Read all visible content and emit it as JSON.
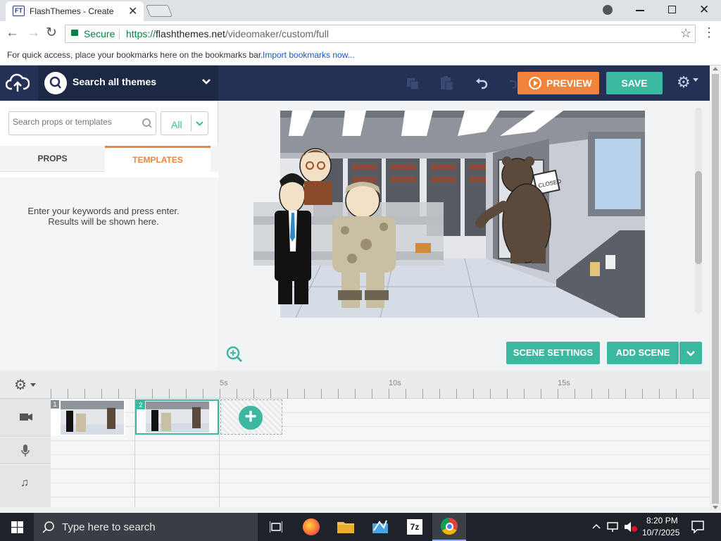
{
  "browser": {
    "tab_title": "FlashThemes - Create",
    "tab_favicon_text": "FT",
    "secure_label": "Secure",
    "url_prefix": "https://",
    "url_host": "flashthemes.net",
    "url_path": "/videomaker/custom/full",
    "bookmarks_hint": "For quick access, place your bookmarks here on the bookmarks bar.",
    "import_bookmarks": "Import bookmarks now..."
  },
  "header": {
    "search_themes_label": "Search all themes",
    "preview_label": "PREVIEW",
    "save_label": "SAVE"
  },
  "left_panel": {
    "search_placeholder": "Search props or templates",
    "filter_value": "All",
    "tabs": [
      {
        "label": "PROPS",
        "active": false
      },
      {
        "label": "TEMPLATES",
        "active": true
      }
    ],
    "results_hint_line1": "Enter your keywords and press enter.",
    "results_hint_line2": "Results will be shown here."
  },
  "stage": {
    "closed_sign": "CLOSED",
    "scene_settings_label": "SCENE SETTINGS",
    "add_scene_label": "ADD SCENE"
  },
  "timeline": {
    "ticks": [
      "5s",
      "10s",
      "15s"
    ],
    "scenes": [
      {
        "number": "1",
        "selected": false
      },
      {
        "number": "2",
        "selected": true
      }
    ]
  },
  "taskbar": {
    "search_placeholder": "Type here to search",
    "time": "8:20 PM",
    "date": "10/7/2025",
    "sevenzip_label": "7z"
  },
  "colors": {
    "header_bg": "#243156",
    "accent_teal": "#3db8a0",
    "accent_orange": "#f0843a",
    "active_tab": "#f0843a"
  },
  "icons": [
    "back-icon",
    "forward-icon",
    "reload-icon",
    "lock-icon",
    "star-icon",
    "menu-icon",
    "upload-cloud-icon",
    "search-icon",
    "chevron-down-icon",
    "copy-icon",
    "paste-icon",
    "undo-icon",
    "redo-icon",
    "play-circle-icon",
    "gear-icon",
    "zoom-in-icon",
    "camera-icon",
    "mic-icon",
    "music-icon",
    "plus-icon",
    "windows-icon",
    "taskview-icon",
    "firefox-icon",
    "folder-icon",
    "chrome-icon",
    "notification-icon"
  ]
}
